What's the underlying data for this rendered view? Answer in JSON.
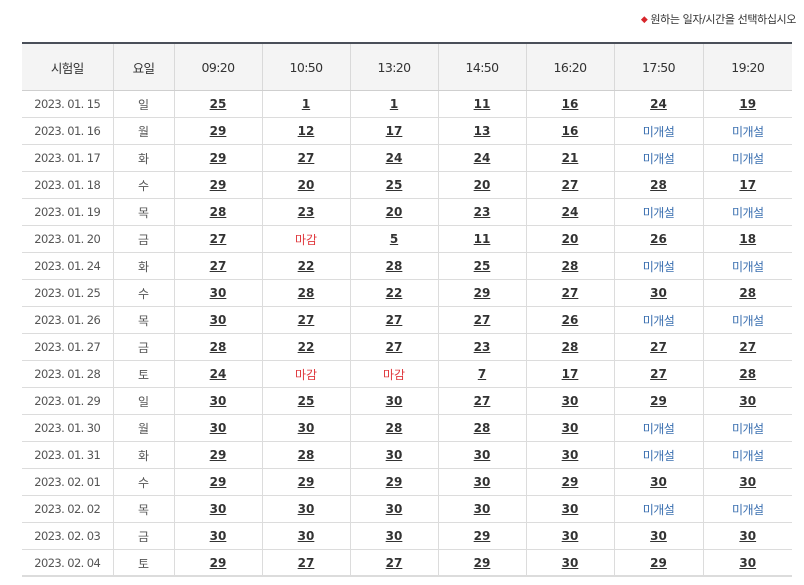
{
  "notice": {
    "icon": "diamond-icon",
    "text": "원하는 일자/시간을 선택하십시오",
    "icon_color": "#d7262b"
  },
  "table": {
    "headers": [
      "시험일",
      "요일",
      "09:20",
      "10:50",
      "13:20",
      "14:50",
      "16:20",
      "17:50",
      "19:20"
    ],
    "rows": [
      {
        "date": "2023. 01. 15",
        "dow": "일",
        "slots": [
          "25",
          "1",
          "1",
          "11",
          "16",
          "24",
          "19"
        ]
      },
      {
        "date": "2023. 01. 16",
        "dow": "월",
        "slots": [
          "29",
          "12",
          "17",
          "13",
          "16",
          "미개설",
          "미개설"
        ]
      },
      {
        "date": "2023. 01. 17",
        "dow": "화",
        "slots": [
          "29",
          "27",
          "24",
          "24",
          "21",
          "미개설",
          "미개설"
        ]
      },
      {
        "date": "2023. 01. 18",
        "dow": "수",
        "slots": [
          "29",
          "20",
          "25",
          "20",
          "27",
          "28",
          "17"
        ]
      },
      {
        "date": "2023. 01. 19",
        "dow": "목",
        "slots": [
          "28",
          "23",
          "20",
          "23",
          "24",
          "미개설",
          "미개설"
        ]
      },
      {
        "date": "2023. 01. 20",
        "dow": "금",
        "slots": [
          "27",
          "마감",
          "5",
          "11",
          "20",
          "26",
          "18"
        ]
      },
      {
        "date": "2023. 01. 24",
        "dow": "화",
        "slots": [
          "27",
          "22",
          "28",
          "25",
          "28",
          "미개설",
          "미개설"
        ]
      },
      {
        "date": "2023. 01. 25",
        "dow": "수",
        "slots": [
          "30",
          "28",
          "22",
          "29",
          "27",
          "30",
          "28"
        ]
      },
      {
        "date": "2023. 01. 26",
        "dow": "목",
        "slots": [
          "30",
          "27",
          "27",
          "27",
          "26",
          "미개설",
          "미개설"
        ]
      },
      {
        "date": "2023. 01. 27",
        "dow": "금",
        "slots": [
          "28",
          "22",
          "27",
          "23",
          "28",
          "27",
          "27"
        ]
      },
      {
        "date": "2023. 01. 28",
        "dow": "토",
        "slots": [
          "24",
          "마감",
          "마감",
          "7",
          "17",
          "27",
          "28"
        ]
      },
      {
        "date": "2023. 01. 29",
        "dow": "일",
        "slots": [
          "30",
          "25",
          "30",
          "27",
          "30",
          "29",
          "30"
        ]
      },
      {
        "date": "2023. 01. 30",
        "dow": "월",
        "slots": [
          "30",
          "30",
          "28",
          "28",
          "30",
          "미개설",
          "미개설"
        ]
      },
      {
        "date": "2023. 01. 31",
        "dow": "화",
        "slots": [
          "29",
          "28",
          "30",
          "30",
          "30",
          "미개설",
          "미개설"
        ]
      },
      {
        "date": "2023. 02. 01",
        "dow": "수",
        "slots": [
          "29",
          "29",
          "29",
          "30",
          "29",
          "30",
          "30"
        ]
      },
      {
        "date": "2023. 02. 02",
        "dow": "목",
        "slots": [
          "30",
          "30",
          "30",
          "30",
          "30",
          "미개설",
          "미개설"
        ]
      },
      {
        "date": "2023. 02. 03",
        "dow": "금",
        "slots": [
          "30",
          "30",
          "30",
          "29",
          "30",
          "30",
          "30"
        ]
      },
      {
        "date": "2023. 02. 04",
        "dow": "토",
        "slots": [
          "29",
          "27",
          "27",
          "29",
          "30",
          "29",
          "30"
        ]
      }
    ],
    "status_colors": {
      "closed": "#e0393e",
      "unopened": "#3a6fb0",
      "available": "#333333"
    },
    "status_labels": {
      "closed": "마감",
      "unopened": "미개설"
    }
  }
}
